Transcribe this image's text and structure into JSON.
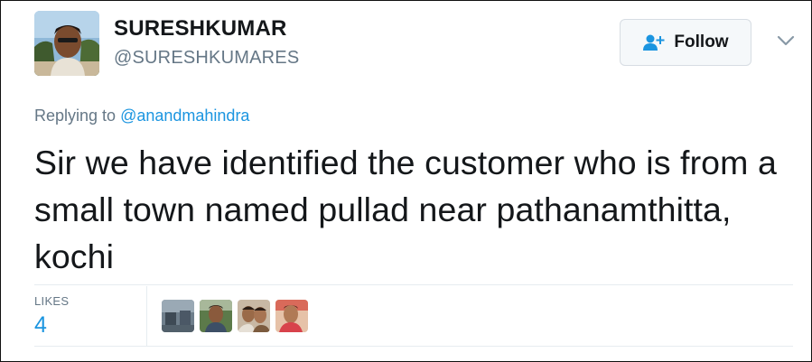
{
  "tweet": {
    "author": {
      "display_name": "SURESHKUMAR",
      "handle": "@SURESHKUMARES"
    },
    "follow_button": {
      "label": "Follow",
      "icon": "follow-person-plus-icon"
    },
    "menu_icon": "chevron-down-icon",
    "replying": {
      "prefix": "Replying to",
      "mention": "@anandmahindra"
    },
    "text": "Sir we have identified the customer who is from a small town named pullad near pathanamthitta, kochi",
    "stats": {
      "likes_label": "LIKES",
      "likes_count": "4"
    },
    "likers_count_shown": 4
  },
  "colors": {
    "link_blue": "#1b95e0",
    "secondary_gray": "#657786",
    "text_dark": "#14171a",
    "button_bg": "#f5f8fa",
    "divider": "#e6ecf0"
  }
}
